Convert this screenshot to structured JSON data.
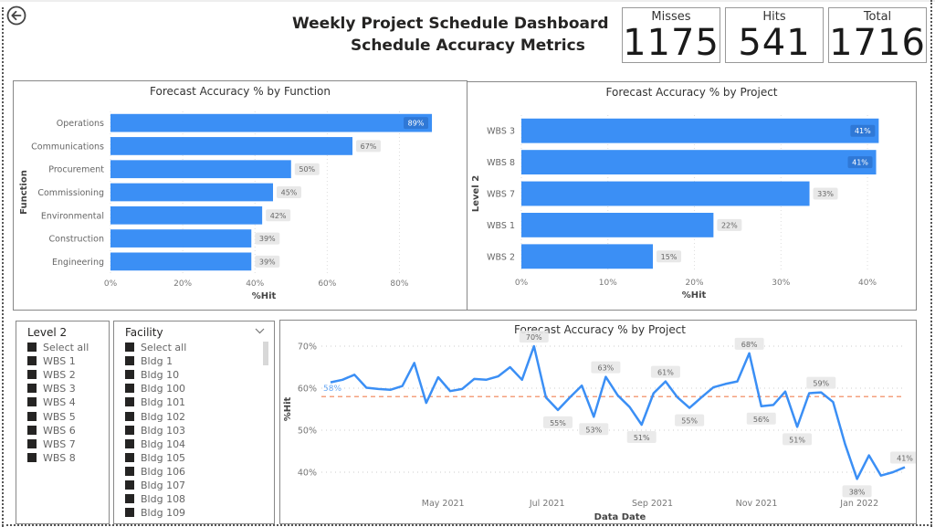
{
  "header": {
    "title_line1": "Weekly Project Schedule Dashboard",
    "title_line2": "Schedule Accuracy Metrics",
    "back_icon": "back-arrow-circle-icon"
  },
  "kpis": [
    {
      "label": "Misses",
      "value": "1175"
    },
    {
      "label": "Hits",
      "value": "541"
    },
    {
      "label": "Total",
      "value": "1716"
    }
  ],
  "colors": {
    "bar": "#3b8ff5",
    "line": "#3b8ff5",
    "average_line": "#f4a07e",
    "label_bg": "#e8e8e8",
    "label_bg_inside": "#2f78d6"
  },
  "slicers": {
    "level2": {
      "title": "Level 2",
      "items": [
        "Select all",
        "WBS 1",
        "WBS 2",
        "WBS 3",
        "WBS 4",
        "WBS 5",
        "WBS 6",
        "WBS 7",
        "WBS 8"
      ]
    },
    "facility": {
      "title": "Facility",
      "items": [
        "Select all",
        "Bldg 1",
        "Bldg 10",
        "Bldg 100",
        "Bldg 101",
        "Bldg 102",
        "Bldg 103",
        "Bldg 104",
        "Bldg 105",
        "Bldg 106",
        "Bldg 107",
        "Bldg 108",
        "Bldg 109"
      ]
    }
  },
  "chart_data": [
    {
      "type": "bar",
      "orientation": "horizontal",
      "title": "Forecast Accuracy % by Function",
      "xlabel": "%Hit",
      "ylabel": "Function",
      "categories": [
        "Operations",
        "Communications",
        "Procurement",
        "Commissioning",
        "Environmental",
        "Construction",
        "Engineering"
      ],
      "values": [
        89,
        67,
        50,
        45,
        42,
        39,
        39
      ],
      "data_labels": [
        "89%",
        "67%",
        "50%",
        "45%",
        "42%",
        "39%",
        "39%"
      ],
      "xlim": [
        0,
        90
      ],
      "xticks": [
        0,
        20,
        40,
        60,
        80
      ],
      "xtick_labels": [
        "0%",
        "20%",
        "40%",
        "60%",
        "80%"
      ],
      "grid": true
    },
    {
      "type": "bar",
      "orientation": "horizontal",
      "title": "Forecast Accuracy % by Project",
      "xlabel": "%Hit",
      "ylabel": "Level 2",
      "categories": [
        "WBS 3",
        "WBS 8",
        "WBS 7",
        "WBS 1",
        "WBS 2"
      ],
      "values": [
        41.3,
        41.0,
        33.3,
        22.2,
        15.2
      ],
      "data_labels": [
        "41%",
        "41%",
        "33%",
        "22%",
        "15%"
      ],
      "xlim": [
        0,
        42
      ],
      "xticks": [
        0,
        10,
        20,
        30,
        40
      ],
      "xtick_labels": [
        "0%",
        "10%",
        "20%",
        "30%",
        "40%"
      ],
      "grid": true
    },
    {
      "type": "line",
      "title": "Forecast Accuracy % by Project",
      "xlabel": "Data Date",
      "ylabel": "%Hit",
      "ylim": [
        37,
        71
      ],
      "yticks": [
        40,
        50,
        60,
        70
      ],
      "ytick_labels": [
        "40%",
        "50%",
        "60%",
        "70%"
      ],
      "xtick_labels": [
        "May 2021",
        "Jul 2021",
        "Sep 2021",
        "Nov 2021",
        "Jan 2022"
      ],
      "x_week_index_of_ticks": [
        9.4,
        18.1,
        26.9,
        35.6,
        44.2
      ],
      "average": 58,
      "average_label": "58%",
      "series": [
        {
          "name": "%Hit",
          "values": [
            61.4,
            62.0,
            63.2,
            60.1,
            59.8,
            59.6,
            60.5,
            66.0,
            56.5,
            62.6,
            59.3,
            59.8,
            62.2,
            62.0,
            62.8,
            65.0,
            62.0,
            70.0,
            57.8,
            54.8,
            57.8,
            60.6,
            53.2,
            62.7,
            58.3,
            55.5,
            51.3,
            58.8,
            61.6,
            57.8,
            55.3,
            57.8,
            60.2,
            61.0,
            61.6,
            68.3,
            55.7,
            56.0,
            59.2,
            50.8,
            58.8,
            59.0,
            56.7,
            46.7,
            38.4,
            44.0,
            39.2,
            40.0,
            41.2
          ],
          "labels": {
            "17": "70%",
            "19": "55%",
            "22": "53%",
            "23": "63%",
            "26": "51%",
            "28": "61%",
            "30": "55%",
            "35": "68%",
            "36": "56%",
            "39": "51%",
            "41": "59%",
            "44": "38%",
            "48": "41%"
          }
        }
      ]
    }
  ]
}
